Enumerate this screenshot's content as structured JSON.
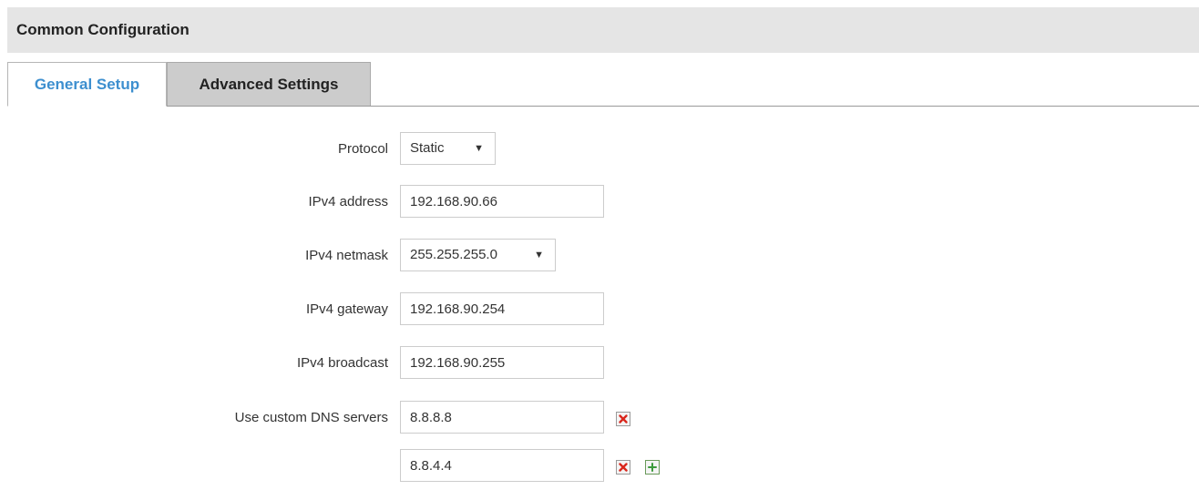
{
  "section": {
    "title": "Common Configuration"
  },
  "tabs": [
    {
      "label": "General Setup",
      "active": true
    },
    {
      "label": "Advanced Settings",
      "active": false
    }
  ],
  "form": {
    "protocol": {
      "label": "Protocol",
      "value": "Static"
    },
    "ipv4_address": {
      "label": "IPv4 address",
      "value": "192.168.90.66"
    },
    "ipv4_netmask": {
      "label": "IPv4 netmask",
      "value": "255.255.255.0"
    },
    "ipv4_gateway": {
      "label": "IPv4 gateway",
      "value": "192.168.90.254"
    },
    "ipv4_broadcast": {
      "label": "IPv4 broadcast",
      "value": "192.168.90.255"
    },
    "dns": {
      "label": "Use custom DNS servers",
      "servers": [
        "8.8.8.8",
        "8.8.4.4"
      ]
    }
  },
  "icons": {
    "caret": "▼",
    "remove": "remove-icon",
    "add": "add-icon"
  },
  "colors": {
    "active_tab_text": "#3d8fcf",
    "remove_icon": "#d9261c",
    "add_icon": "#3b9a3b"
  }
}
